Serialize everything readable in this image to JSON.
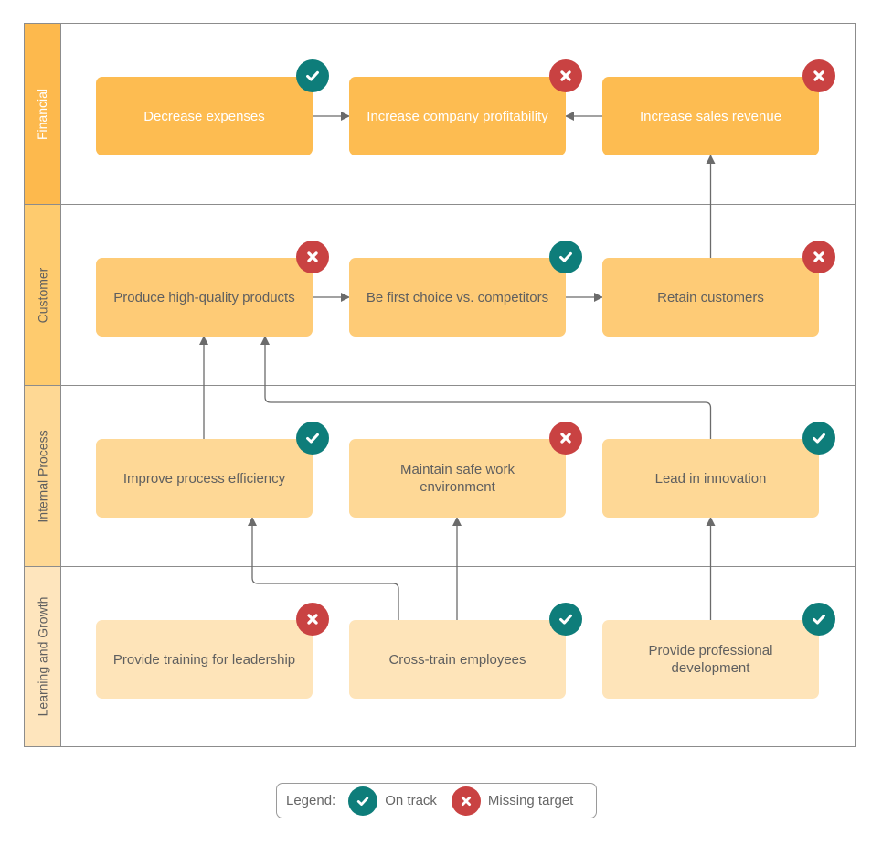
{
  "colors": {
    "on_track": "#0e7d7a",
    "missing_target": "#c94242",
    "connector": "#6b6b6b",
    "text_light": "#ffffff",
    "text_dark": "#5f5f5f"
  },
  "lanes": [
    {
      "title": "Financial",
      "header_color": "#fdb94d",
      "node_color": "#fdbc51",
      "text_style": "light"
    },
    {
      "title": "Customer",
      "header_color": "#fecb6e",
      "node_color": "#fecb76",
      "text_style": "dark"
    },
    {
      "title": "Internal Process",
      "header_color": "#fed894",
      "node_color": "#fed896",
      "text_style": "dark"
    },
    {
      "title": "Learning and Growth",
      "header_color": "#fee5bd",
      "node_color": "#fee4b9",
      "text_style": "dark"
    }
  ],
  "nodes": [
    {
      "id": "decrease-expenses",
      "lane": 0,
      "col": 0,
      "label": "Decrease expenses",
      "status": "on_track"
    },
    {
      "id": "increase-profitability",
      "lane": 0,
      "col": 1,
      "label": "Increase company profitability",
      "status": "missing_target"
    },
    {
      "id": "increase-sales-revenue",
      "lane": 0,
      "col": 2,
      "label": "Increase sales revenue",
      "status": "missing_target"
    },
    {
      "id": "produce-quality-products",
      "lane": 1,
      "col": 0,
      "label": "Produce high-quality products",
      "status": "missing_target"
    },
    {
      "id": "first-choice",
      "lane": 1,
      "col": 1,
      "label": "Be first choice vs. competitors",
      "status": "on_track"
    },
    {
      "id": "retain-customers",
      "lane": 1,
      "col": 2,
      "label": "Retain customers",
      "status": "missing_target"
    },
    {
      "id": "improve-efficiency",
      "lane": 2,
      "col": 0,
      "label": "Improve process efficiency",
      "status": "on_track"
    },
    {
      "id": "safe-work-environment",
      "lane": 2,
      "col": 1,
      "label": "Maintain safe work environment",
      "status": "missing_target"
    },
    {
      "id": "lead-innovation",
      "lane": 2,
      "col": 2,
      "label": "Lead in innovation",
      "status": "on_track"
    },
    {
      "id": "leadership-training",
      "lane": 3,
      "col": 0,
      "label": "Provide training for leadership",
      "status": "missing_target"
    },
    {
      "id": "cross-train",
      "lane": 3,
      "col": 1,
      "label": "Cross-train employees",
      "status": "on_track"
    },
    {
      "id": "professional-development",
      "lane": 3,
      "col": 2,
      "label": "Provide professional development",
      "status": "on_track"
    }
  ],
  "connections": [
    {
      "from": "decrease-expenses",
      "to": "increase-profitability"
    },
    {
      "from": "increase-sales-revenue",
      "to": "increase-profitability"
    },
    {
      "from": "retain-customers",
      "to": "increase-sales-revenue"
    },
    {
      "from": "produce-quality-products",
      "to": "first-choice"
    },
    {
      "from": "first-choice",
      "to": "retain-customers"
    },
    {
      "from": "improve-efficiency",
      "to": "produce-quality-products"
    },
    {
      "from": "lead-innovation",
      "to": "produce-quality-products"
    },
    {
      "from": "cross-train",
      "to": "improve-efficiency"
    },
    {
      "from": "cross-train",
      "to": "safe-work-environment"
    },
    {
      "from": "professional-development",
      "to": "lead-innovation"
    }
  ],
  "legend": {
    "label": "Legend:",
    "on_track": "On track",
    "missing_target": "Missing target"
  }
}
